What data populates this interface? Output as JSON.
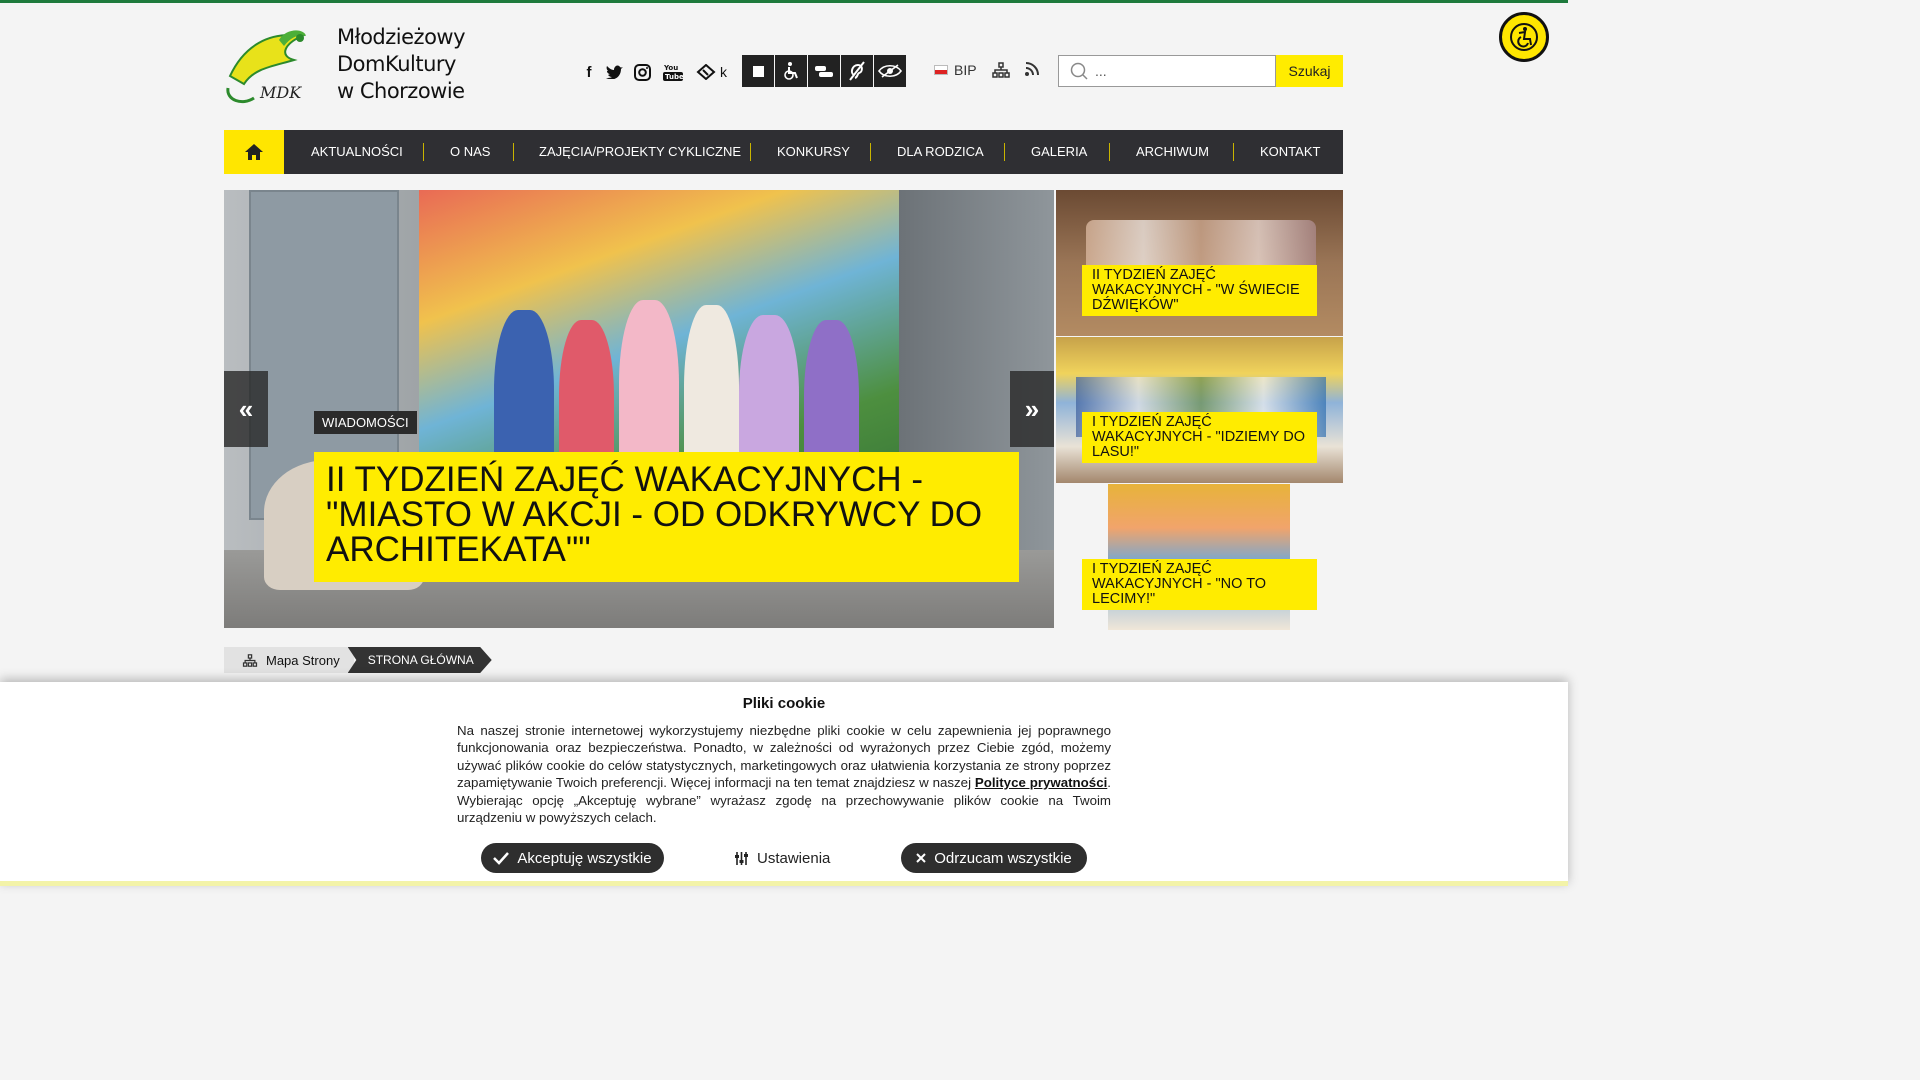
{
  "logo": {
    "line1": "Młodzieżowy",
    "line2": "DomKultury",
    "line3": "w Chorzowie",
    "badge": "MDK"
  },
  "social": {
    "facebook": "f",
    "twitter": "twitter-icon",
    "instagram": "instagram-icon",
    "youtube": "youtube-icon",
    "ticket_suffix": "k"
  },
  "header": {
    "bip_label": "BIP"
  },
  "search": {
    "value": "...",
    "button": "Szukaj"
  },
  "nav": {
    "items": [
      "Aktualności",
      "O nas",
      "Zajęcia/Projekty cykliczne",
      "Konkursy",
      "Dla rodzica",
      "Galeria",
      "Archiwum",
      "Kontakt"
    ]
  },
  "hero": {
    "tag": "Wiadomości",
    "title": "II tydzień zajęć wakacyjnych - \"Miasto w akcji - od odkrywcy do architekata\"\""
  },
  "side": [
    {
      "title": "II tydzień zajęć wakacyjnych - \"W świecie dźwięków\""
    },
    {
      "title": "I tydzień zajęć wakacyjnych - \"Idziemy do lasu!\""
    },
    {
      "title": "I tydzień zajęć wakacyjnych - \"No to lecimy!\""
    }
  ],
  "breadcrumb": {
    "sitemap": "Mapa Strony",
    "current": "Strona Główna"
  },
  "cookie": {
    "title": "Pliki cookie",
    "text_before": "Na naszej stronie internetowej wykorzystujemy niezbędne pliki cookie w celu zapewnienia jej poprawnego funkcjonowania oraz bezpieczeństwa. Ponadto, w zależności od wyrażonych przez Ciebie zgód, możemy używać plików cookie do celów statystycznych, marketingowych oraz ułatwienia korzystania ze strony poprzez zapamiętywanie Twoich preferencji. Więcej informacji na ten temat znajdziesz w naszej ",
    "link": "Polityce prywatności",
    "text_after": ". Wybierając opcję „Akceptuję wybrane” wyrażasz zgodę na przechowywanie plików cookie na Twoim urządzeniu w powyższych celach.",
    "accept": "Akceptuję wszystkie",
    "settings": "Ustawienia",
    "reject": "Odrzucam wszystkie"
  },
  "colors": {
    "accent": "#ffec00",
    "nav_bg": "#2f2f33",
    "top_line": "#1e7a3c"
  }
}
